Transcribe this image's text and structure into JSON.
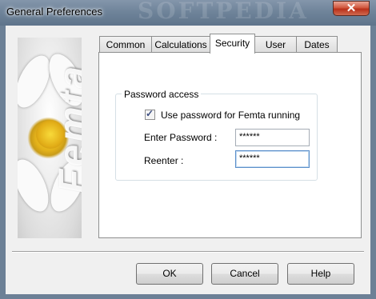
{
  "window": {
    "title": "General Preferences",
    "watermark": "SOFTPEDIA",
    "close_glyph": "✕"
  },
  "side_image": {
    "brand_text": "Femta"
  },
  "tabs": [
    {
      "label": "Common",
      "active": false
    },
    {
      "label": "Calculations",
      "active": false
    },
    {
      "label": "Security",
      "active": true
    },
    {
      "label": "User",
      "active": false
    },
    {
      "label": "Dates",
      "active": false
    }
  ],
  "security": {
    "group_title": "Password access",
    "use_password_label": "Use password for Femta running",
    "use_password_checked": true,
    "enter_password_label": "Enter Password :",
    "enter_password_value": "******",
    "reenter_label": "Reenter :",
    "reenter_value": "******"
  },
  "buttons": {
    "ok": "OK",
    "cancel": "Cancel",
    "help": "Help"
  },
  "colors": {
    "title_bar": "#6f849a",
    "close_button": "#c9452b",
    "focus_border": "#5a8ec9"
  }
}
